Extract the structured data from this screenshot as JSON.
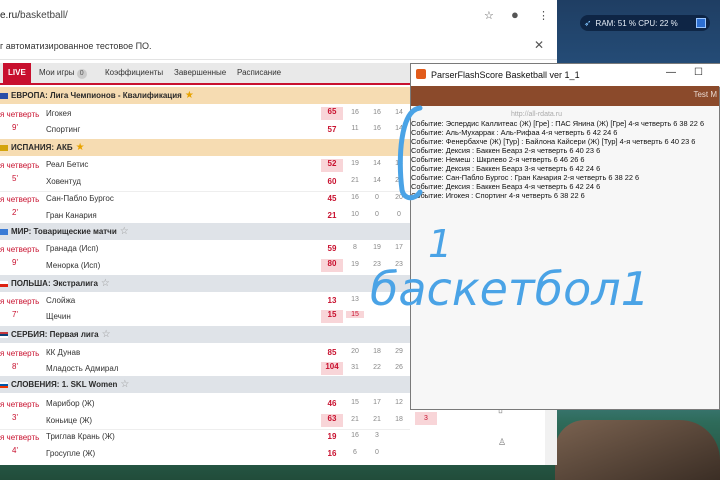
{
  "browser": {
    "url_prefix": "e.ru/",
    "url_path": "basketball/",
    "infobar_text": "г автоматизированное тестовое ПО.",
    "tabs": [
      {
        "label": "LIVE"
      },
      {
        "label": "Мои игры",
        "count": "0"
      },
      {
        "label": "Коэффициенты"
      },
      {
        "label": "Завершенные"
      },
      {
        "label": "Расписание"
      }
    ]
  },
  "system": {
    "widget_text": "RAM: 51 % CPU: 22 %"
  },
  "leagues": [
    {
      "name": "ЕВРОПА: Лига Чемпионов - Квалификация",
      "fav": true
    },
    {
      "name": "ИСПАНИЯ: АКБ",
      "fav": true
    },
    {
      "name": "МИР: Товарищеские матчи",
      "fav": false
    },
    {
      "name": "ПОЛЬША: Экстралига",
      "fav": false
    },
    {
      "name": "СЕРБИЯ: Первая лига",
      "fav": false
    },
    {
      "name": "СЛОВЕНИЯ: 1. SKL Women",
      "fav": false
    }
  ],
  "matches": [
    {
      "period": "я четверть",
      "minute": "9'",
      "home": "Игокея",
      "away": "Спортинг",
      "hs": "65",
      "as": "57",
      "hq": [
        "16",
        "16",
        "14"
      ],
      "aq": [
        "11",
        "16",
        "14"
      ]
    },
    {
      "period": "я четверть",
      "minute": "5'",
      "home": "Реал Бетис",
      "away": "Ховентуд",
      "hs": "52",
      "as": "60",
      "hq": [
        "19",
        "14",
        "14"
      ],
      "aq": [
        "21",
        "14",
        "21"
      ]
    },
    {
      "period": "я четверть",
      "minute": "2'",
      "home": "Сан-Пабло Бургос",
      "away": "Гран Канария",
      "hs": "45",
      "as": "21",
      "hq": [
        "16",
        "0",
        "20"
      ],
      "aq": [
        "10",
        "0",
        "0"
      ]
    },
    {
      "period": "я четверть",
      "minute": "9'",
      "home": "Гранада (Исп)",
      "away": "Менорка (Исп)",
      "hs": "59",
      "as": "80",
      "hq": [
        "8",
        "19",
        "17"
      ],
      "aq": [
        "19",
        "23",
        "23"
      ]
    },
    {
      "period": "я четверть",
      "minute": "7'",
      "home": "Слойжа",
      "away": "Щечин",
      "hs": "13",
      "as": "15",
      "hq": [
        "13"
      ],
      "aq": [
        "15"
      ]
    },
    {
      "period": "я четверть",
      "minute": "8'",
      "home": "КК Дунав",
      "away": "Младость Адмирал",
      "hs": "85",
      "as": "104",
      "hq": [
        "20",
        "18",
        "29"
      ],
      "aq": [
        "31",
        "22",
        "26"
      ]
    },
    {
      "period": "я четверть",
      "minute": "3'",
      "home": "Марибор (Ж)",
      "away": "Коньице (Ж)",
      "hs": "46",
      "as": "63",
      "hq": [
        "15",
        "17",
        "12"
      ],
      "aq": [
        "21",
        "21",
        "18"
      ],
      "extra": "3"
    },
    {
      "period": "я четверть",
      "minute": "4'",
      "home": "Триглав Крань (Ж)",
      "away": "Гросупле (Ж)",
      "hs": "19",
      "as": "16",
      "hq": [
        "16",
        "3"
      ],
      "aq": [
        "6",
        "0"
      ]
    }
  ],
  "parser": {
    "title": "ParserFlashScore Basketball ver 1_1",
    "toolbar_text": "Test M",
    "url_hint": "http://all-rdata.ru",
    "lines": [
      "Событие: Эспердис Каллитеас (Ж) [Гре] : ПАС Янина (Ж) [Гре] 4-я четверть 6  38 22 6",
      "Событие: Аль-Мухаррак : Аль-Рифаа 4-я четверть 6  42 24 6",
      "Событие: Фенербахче (Ж) [Тур] : Байлона Кайсери (Ж) [Тур] 4-я четверть 6  40 23 6",
      "Событие: Дексия : Баккен Беарз 2-я четверть 6  40 23 6",
      "Событие: Немеш : Шкрлево 2-я четверть 6  46 26 6",
      "Событие: Дексия : Баккен Беарз 3-я четверть 6  42 24 6",
      "Событие: Сан-Пабло Бургос : Гран Канария 2-я четверть 6  38 22 6",
      "Событие: Дексия : Баккен Беарз 4-я четверть 6  42 24 6",
      "Событие: Игокея : Спортинг 4-я четверть 6  38 22 6"
    ]
  },
  "annotation": {
    "number": "1",
    "word": "баскетбол1"
  },
  "colors": {
    "accent": "#c8102e",
    "fav_league": "#f6dcb2",
    "parser_toolbar": "#8b4a2b",
    "handwriting": "#4aa3e6"
  }
}
